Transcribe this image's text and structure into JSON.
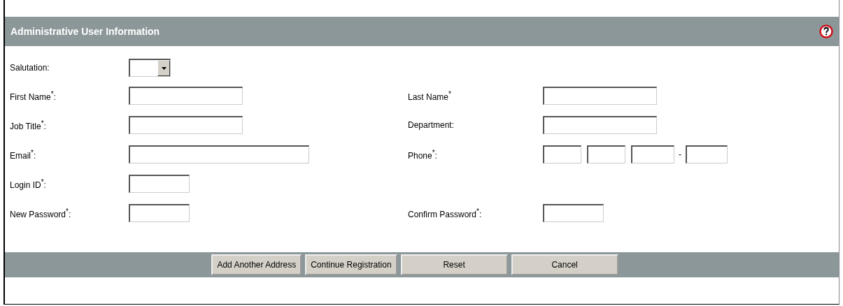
{
  "header": {
    "title": "Administrative User Information"
  },
  "rows": [
    {
      "left": {
        "label": "Salutation:",
        "kind": "select"
      }
    },
    {
      "left": {
        "label": "First Name$^{*}$:",
        "kind": "medium"
      },
      "right": {
        "label": "Last Name$^{*}$",
        "kind": "medium"
      }
    },
    {
      "left": {
        "label": "Job Title$^{*}$:",
        "kind": "medium"
      },
      "right": {
        "label": "Department:",
        "kind": "medium"
      }
    },
    {
      "left": {
        "label": "Email$^{*}$:",
        "kind": "long"
      },
      "right": {
        "label": "Phone$^{*}$:",
        "kind": "phone",
        "separator": "-"
      }
    },
    {
      "left": {
        "label": "Login ID$^{*}$:",
        "kind": "short"
      }
    },
    {
      "left": {
        "label": "New Password$^{*}$:",
        "kind": "short"
      },
      "right": {
        "label": "Confirm Password$^{*}$:",
        "kind": "short"
      }
    }
  ],
  "buttons": [
    "Add Another Address",
    "Continue Registration",
    "Reset",
    "Cancel"
  ]
}
